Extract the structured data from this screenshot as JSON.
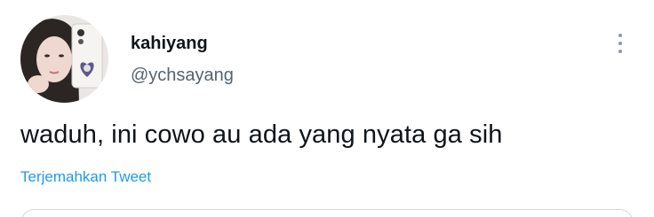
{
  "user": {
    "display_name": "kahiyang",
    "handle": "@ychsayang",
    "avatar_icon": "profile-photo"
  },
  "tweet": {
    "text": "waduh, ini cowo au ada yang nyata ga sih",
    "translate_label": "Terjemahkan Tweet"
  },
  "menu": {
    "icon": "more-vertical-icon"
  },
  "colors": {
    "text_primary": "#0f1419",
    "text_secondary": "#536471",
    "link": "#1d9bf0",
    "border": "#cfd9de"
  }
}
